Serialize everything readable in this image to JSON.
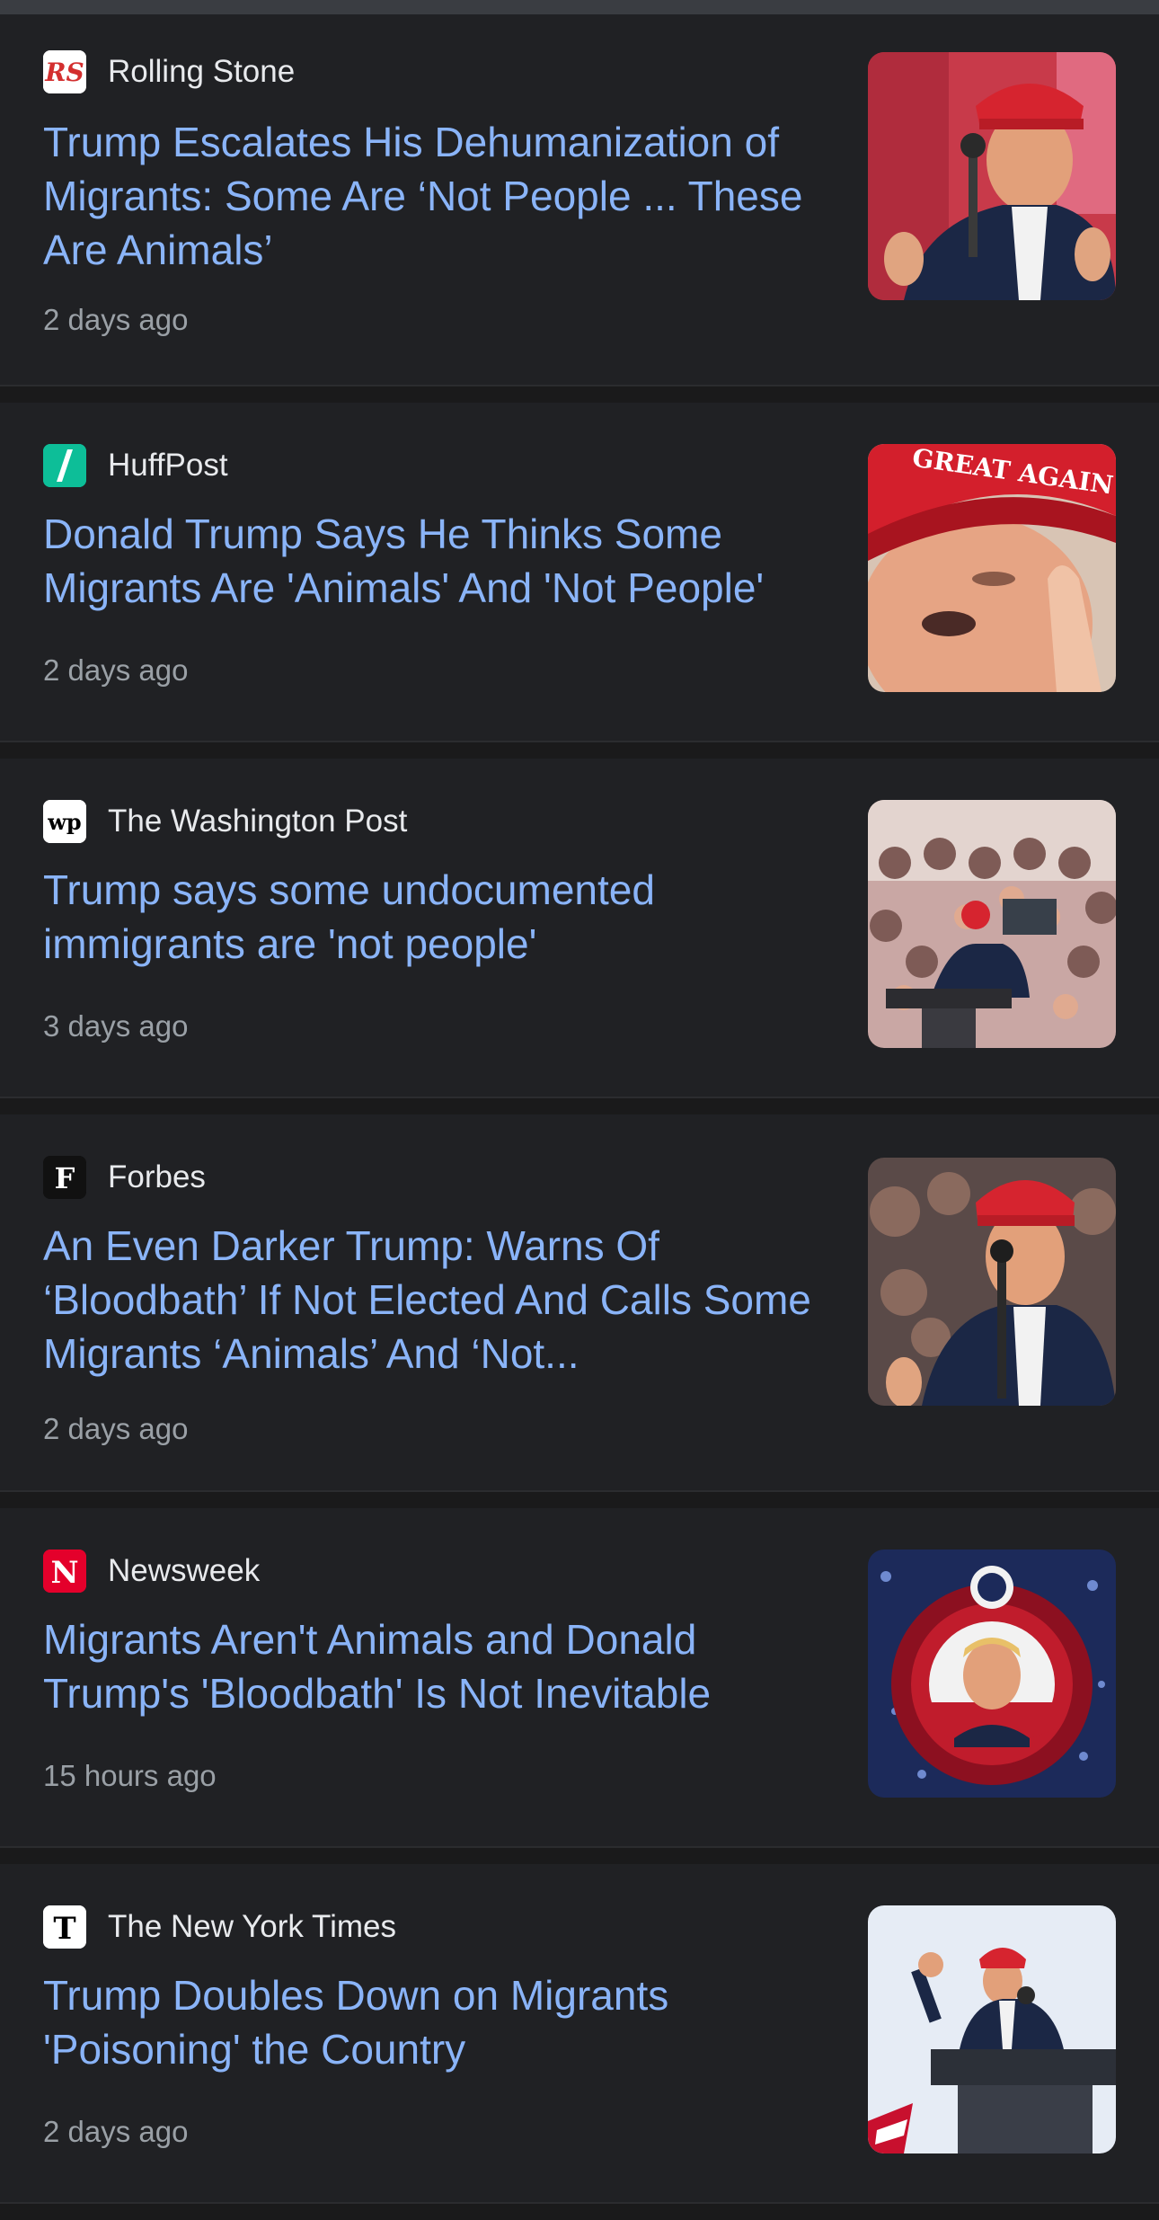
{
  "articles": [
    {
      "source": "Rolling Stone",
      "favicon_icon": "rolling-stone-logo-icon",
      "favicon_color": "#d32f2f",
      "headline": "Trump Escalates His Dehumanization of Migrants: Some Are ‘Not People ... These Are Animals’",
      "time": "2 days ago",
      "thumbnail": "trump-speaking-at-microphone-red-cap"
    },
    {
      "source": "HuffPost",
      "favicon_icon": "huffpost-logo-icon",
      "favicon_color": "#0dbe98",
      "headline": "Donald Trump Says He Thinks Some Migrants Are 'Animals' And 'Not People'",
      "time": "2 days ago",
      "thumbnail": "trump-close-up-great-again-cap"
    },
    {
      "source": "The Washington Post",
      "favicon_icon": "washington-post-logo-icon",
      "favicon_color": "#ffffff",
      "headline": "Trump says some undocumented immigrants are 'not people'",
      "time": "3 days ago",
      "thumbnail": "trump-rally-crowd"
    },
    {
      "source": "Forbes",
      "favicon_icon": "forbes-logo-icon",
      "favicon_color": "#111111",
      "headline": "An Even Darker Trump: Warns Of ‘Bloodbath’ If Not Elected And Calls Some Migrants ‘Animals’ And ‘Not...",
      "time": "2 days ago",
      "thumbnail": "trump-speaking-with-crowd-behind"
    },
    {
      "source": "Newsweek",
      "favicon_icon": "newsweek-logo-icon",
      "favicon_color": "#e4002b",
      "headline": "Migrants Aren't Animals and Donald Trump's 'Bloodbath' Is Not Inevitable",
      "time": "15 hours ago",
      "thumbnail": "trump-campaign-button"
    },
    {
      "source": "The New York Times",
      "favicon_icon": "new-york-times-logo-icon",
      "favicon_color": "#ffffff",
      "headline": "Trump Doubles Down on Migrants 'Poisoning' the Country",
      "time": "2 days ago",
      "thumbnail": "trump-at-podium-fist-raised"
    }
  ],
  "colors": {
    "background": "#202124",
    "headline_link": "#8ab4f8",
    "source_text": "#e8eaed",
    "timestamp_text": "#9aa0a6"
  }
}
